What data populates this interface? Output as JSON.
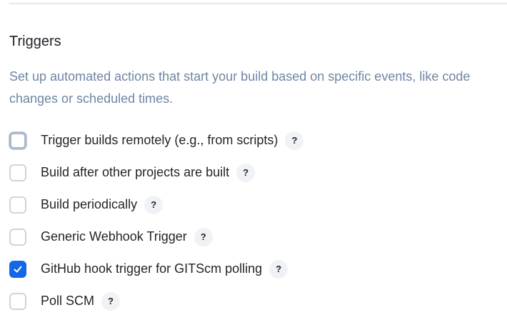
{
  "section": {
    "title": "Triggers",
    "description": "Set up automated actions that start your build based on specific events, like code changes or scheduled times."
  },
  "triggers": [
    {
      "label": "Trigger builds remotely (e.g., from scripts)",
      "checked": false,
      "focused": true,
      "help": "?"
    },
    {
      "label": "Build after other projects are built",
      "checked": false,
      "focused": false,
      "help": "?"
    },
    {
      "label": "Build periodically",
      "checked": false,
      "focused": false,
      "help": "?"
    },
    {
      "label": "Generic Webhook Trigger",
      "checked": false,
      "focused": false,
      "help": "?"
    },
    {
      "label": "GitHub hook trigger for GITScm polling",
      "checked": true,
      "focused": false,
      "help": "?"
    },
    {
      "label": "Poll SCM",
      "checked": false,
      "focused": false,
      "help": "?"
    }
  ],
  "icons": {
    "checked": "check-icon",
    "help": "question-mark-icon"
  },
  "colors": {
    "accent": "#1467e6",
    "description": "#6e86a3",
    "checkbox_border": "#cfd5dd"
  }
}
